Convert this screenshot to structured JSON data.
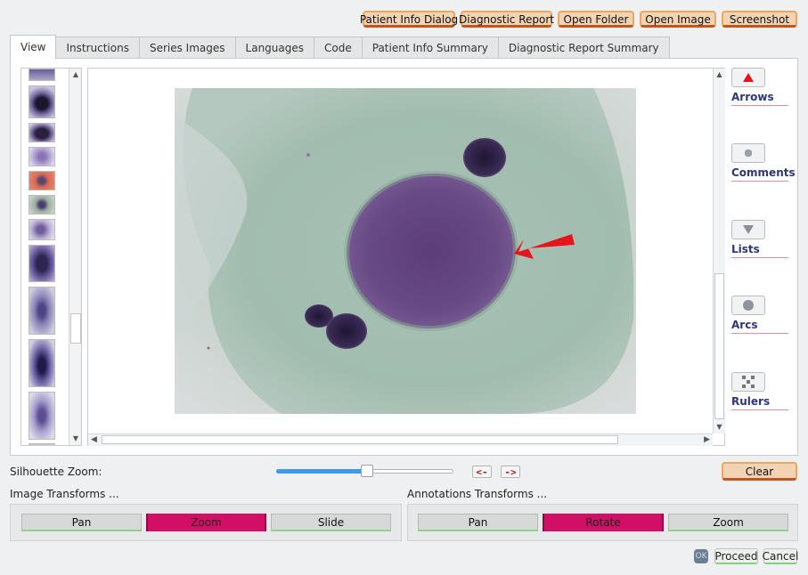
{
  "toolbar": {
    "patient_info_dialog": "Patient Info Dialog",
    "diagnostic_report": "Diagnostic Report",
    "open_folder": "Open Folder",
    "open_image": "Open Image",
    "screenshot": "Screenshot"
  },
  "tabs": [
    "View",
    "Instructions",
    "Series Images",
    "Languages",
    "Code",
    "Patient Info Summary",
    "Diagnostic Report Summary"
  ],
  "active_tab": "View",
  "tools": {
    "arrows": "Arrows",
    "comments": "Comments",
    "lists": "Lists",
    "arcs": "Arcs",
    "rulers": "Rulers"
  },
  "silhouette_zoom": {
    "label": "Silhouette Zoom:",
    "value_fraction": 0.51,
    "prev": "<-",
    "next": "->"
  },
  "clear_label": "Clear",
  "image_transforms": {
    "title": "Image Transforms ...",
    "buttons": [
      "Pan",
      "Zoom",
      "Slide"
    ],
    "active": "Zoom"
  },
  "annotation_transforms": {
    "title": "Annotations Transforms ...",
    "buttons": [
      "Pan",
      "Rotate",
      "Zoom"
    ],
    "active": "Rotate"
  },
  "footer": {
    "ok": "OK",
    "proceed": "Proceed",
    "cancel": "Cancel"
  },
  "colors": {
    "accent_button": "#f2d4b5",
    "active_toggle": "#d10f64",
    "arrow_annotation": "#e8141c",
    "tool_label": "#2f3577"
  }
}
